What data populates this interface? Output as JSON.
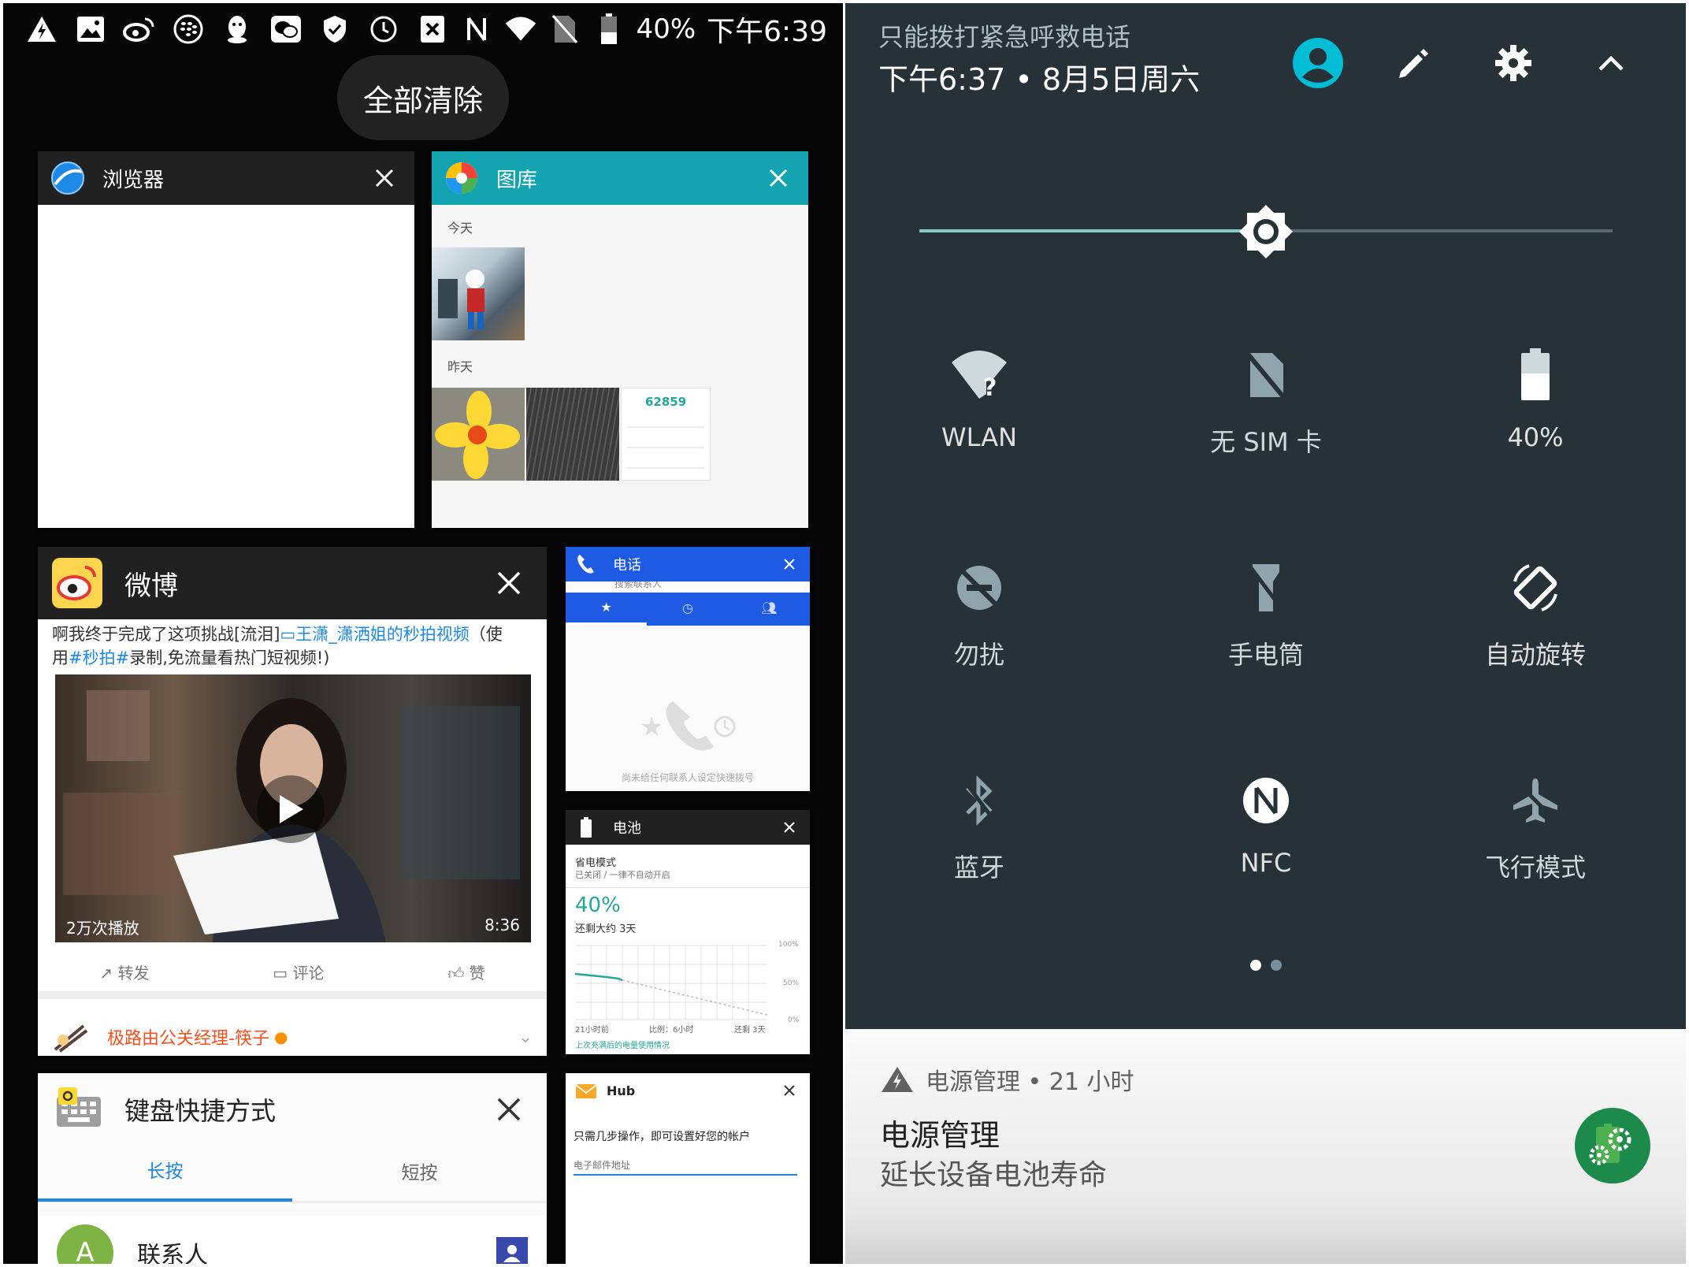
{
  "status_bar": {
    "battery_percent": "40%",
    "time": "下午6:39",
    "icons": [
      "alert-icon",
      "gallery-icon",
      "weibo-icon",
      "blackberry-icon",
      "qq-icon",
      "wechat-icon",
      "shield-icon",
      "clock-icon",
      "x-box-icon",
      "nfc-icon",
      "wifi-icon",
      "no-sim-icon",
      "battery-icon"
    ]
  },
  "recents": {
    "clear_all_label": "全部清除",
    "cards": {
      "browser": {
        "title": "浏览器"
      },
      "gallery": {
        "title": "图库",
        "today_label": "今天",
        "yesterday_label": "昨天",
        "score_value": "62859"
      },
      "weibo": {
        "title": "微博",
        "post_text_1": "啊我终于完成了这项挑战[流泪]",
        "post_link": "王潇_潇洒姐的秒拍视频",
        "post_text_2": "（使",
        "post_text_3": "用",
        "post_hashtag": "#秒拍#",
        "post_text_4": "录制,免流量看热门短视频!)",
        "video_views": "2万次播放",
        "video_duration": "8:36",
        "action_repost": "转发",
        "action_comment": "评论",
        "action_like": "赞",
        "next_author": "极路由公关经理-筷子"
      },
      "phone": {
        "title": "电话",
        "search_placeholder": "搜索联系人",
        "empty_text": "尚未给任何联系人设定快速拨号"
      },
      "battery": {
        "title": "电池",
        "saver_title": "省电模式",
        "saver_sub": "已关闭 / 一律不自动开启",
        "percent": "40%",
        "remaining": "还剩大约 3天",
        "y_100": "100%",
        "y_50": "50%",
        "y_0": "0%",
        "x_left": "21小时前",
        "x_mid": "比例：6小时",
        "x_right": "还剩 3天",
        "link": "上次充满后的电量使用情况"
      },
      "keyboard": {
        "title": "键盘快捷方式",
        "tab_long": "长按",
        "tab_short": "短按",
        "contact_initial": "A",
        "contact_label": "联系人"
      },
      "hub": {
        "title": "Hub",
        "setup_text": "只需几步操作，即可设置好您的帐户",
        "email_placeholder": "电子邮件地址"
      }
    }
  },
  "quick_settings": {
    "emergency_text": "只能拨打紧急呼救电话",
    "datetime": "下午6:37 • 8月5日周六",
    "brightness_level": 0.5,
    "accent_color": "#80cbc4",
    "tiles": {
      "wlan": "WLAN",
      "sim": "无 SIM 卡",
      "battery": "40%",
      "dnd": "勿扰",
      "flashlight": "手电筒",
      "rotate": "自动旋转",
      "bluetooth": "蓝牙",
      "nfc": "NFC",
      "airplane": "飞行模式"
    },
    "page_count": 2
  },
  "notification": {
    "app_line": "电源管理 • 21 小时",
    "title": "电源管理",
    "text": "延长设备电池寿命"
  }
}
